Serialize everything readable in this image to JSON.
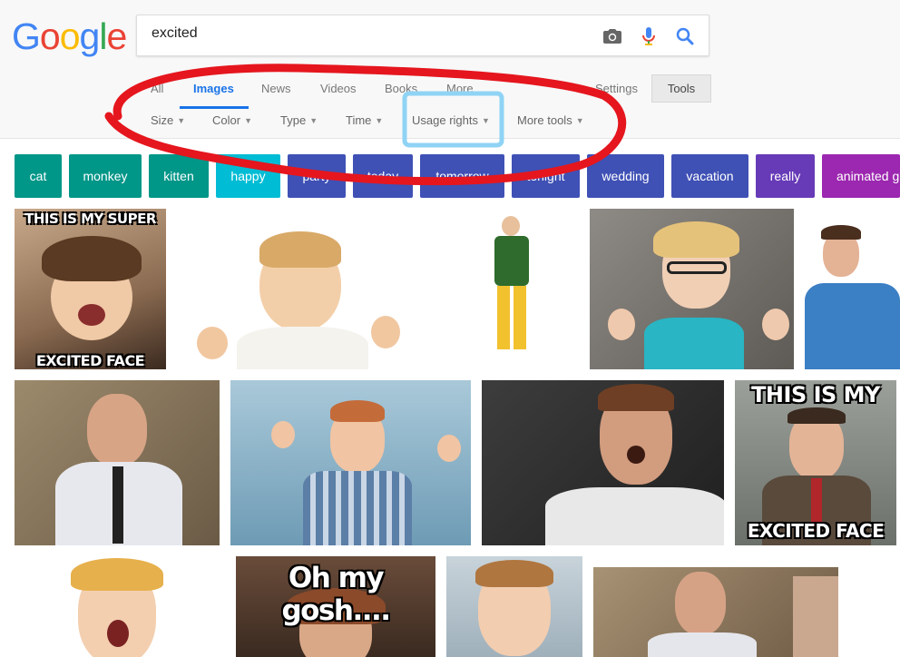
{
  "logo": {
    "letters": [
      "G",
      "o",
      "o",
      "g",
      "l",
      "e"
    ],
    "colors": [
      "#4285f4",
      "#ea4335",
      "#fbbc05",
      "#4285f4",
      "#34a853",
      "#ea4335"
    ]
  },
  "search": {
    "query": "excited"
  },
  "tabs": [
    {
      "label": "All"
    },
    {
      "label": "Images"
    },
    {
      "label": "News"
    },
    {
      "label": "Videos"
    },
    {
      "label": "Books"
    },
    {
      "label": "More"
    }
  ],
  "settings_label": "Settings",
  "tools_label": "Tools",
  "filters": [
    {
      "label": "Size"
    },
    {
      "label": "Color"
    },
    {
      "label": "Type"
    },
    {
      "label": "Time"
    },
    {
      "label": "Usage rights"
    },
    {
      "label": "More tools"
    }
  ],
  "chips": [
    {
      "label": "cat",
      "color": "#009688"
    },
    {
      "label": "monkey",
      "color": "#009688"
    },
    {
      "label": "kitten",
      "color": "#009688"
    },
    {
      "label": "happy",
      "color": "#00bcd4"
    },
    {
      "label": "party",
      "color": "#3f51b5"
    },
    {
      "label": "today",
      "color": "#3f51b5"
    },
    {
      "label": "tomorrow",
      "color": "#3f51b5"
    },
    {
      "label": "tonight",
      "color": "#3f51b5"
    },
    {
      "label": "wedding",
      "color": "#3f51b5"
    },
    {
      "label": "vacation",
      "color": "#3f51b5"
    },
    {
      "label": "really",
      "color": "#673ab7"
    },
    {
      "label": "animated gif",
      "color": "#9c27b0"
    }
  ],
  "memes": {
    "t1_top": "THIS IS MY SUPER",
    "t1_bottom": "EXCITED FACE",
    "t9_top": "THIS IS MY",
    "t9_bottom": "EXCITED FACE",
    "t11_top": "Oh my gosh...."
  },
  "annotation_colors": {
    "red": "#e5161e",
    "blue": "#8fd3f5"
  }
}
